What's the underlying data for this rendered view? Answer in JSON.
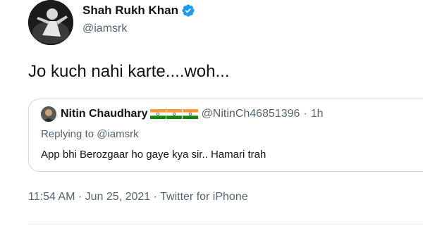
{
  "tweet": {
    "author": {
      "name": "Shah Rukh Khan",
      "handle": "@iamsrk",
      "verified": true,
      "verified_icon": "verified-badge-icon"
    },
    "text": "Jo kuch nahi karte....woh...",
    "quoted": {
      "author_name": "Nitin Chaudhary",
      "flags": [
        "india-flag-icon",
        "india-flag-icon",
        "india-flag-icon"
      ],
      "handle": "@NitinCh46851396",
      "separator": "·",
      "time": "1h",
      "replying_to": "Replying to @iamsrk",
      "text": "App bhi Berozgaar ho gaye kya sir.. Hamari trah"
    },
    "meta": {
      "time": "11:54 AM",
      "separator": "·",
      "date": "Jun 25, 2021",
      "source": "Twitter for iPhone"
    }
  },
  "colors": {
    "text": "#0f1419",
    "secondary": "#536471",
    "border": "#cfd9de",
    "verified": "#1d9bf0",
    "saffron": "#ff9933",
    "green": "#138808",
    "chakra": "#000080"
  }
}
